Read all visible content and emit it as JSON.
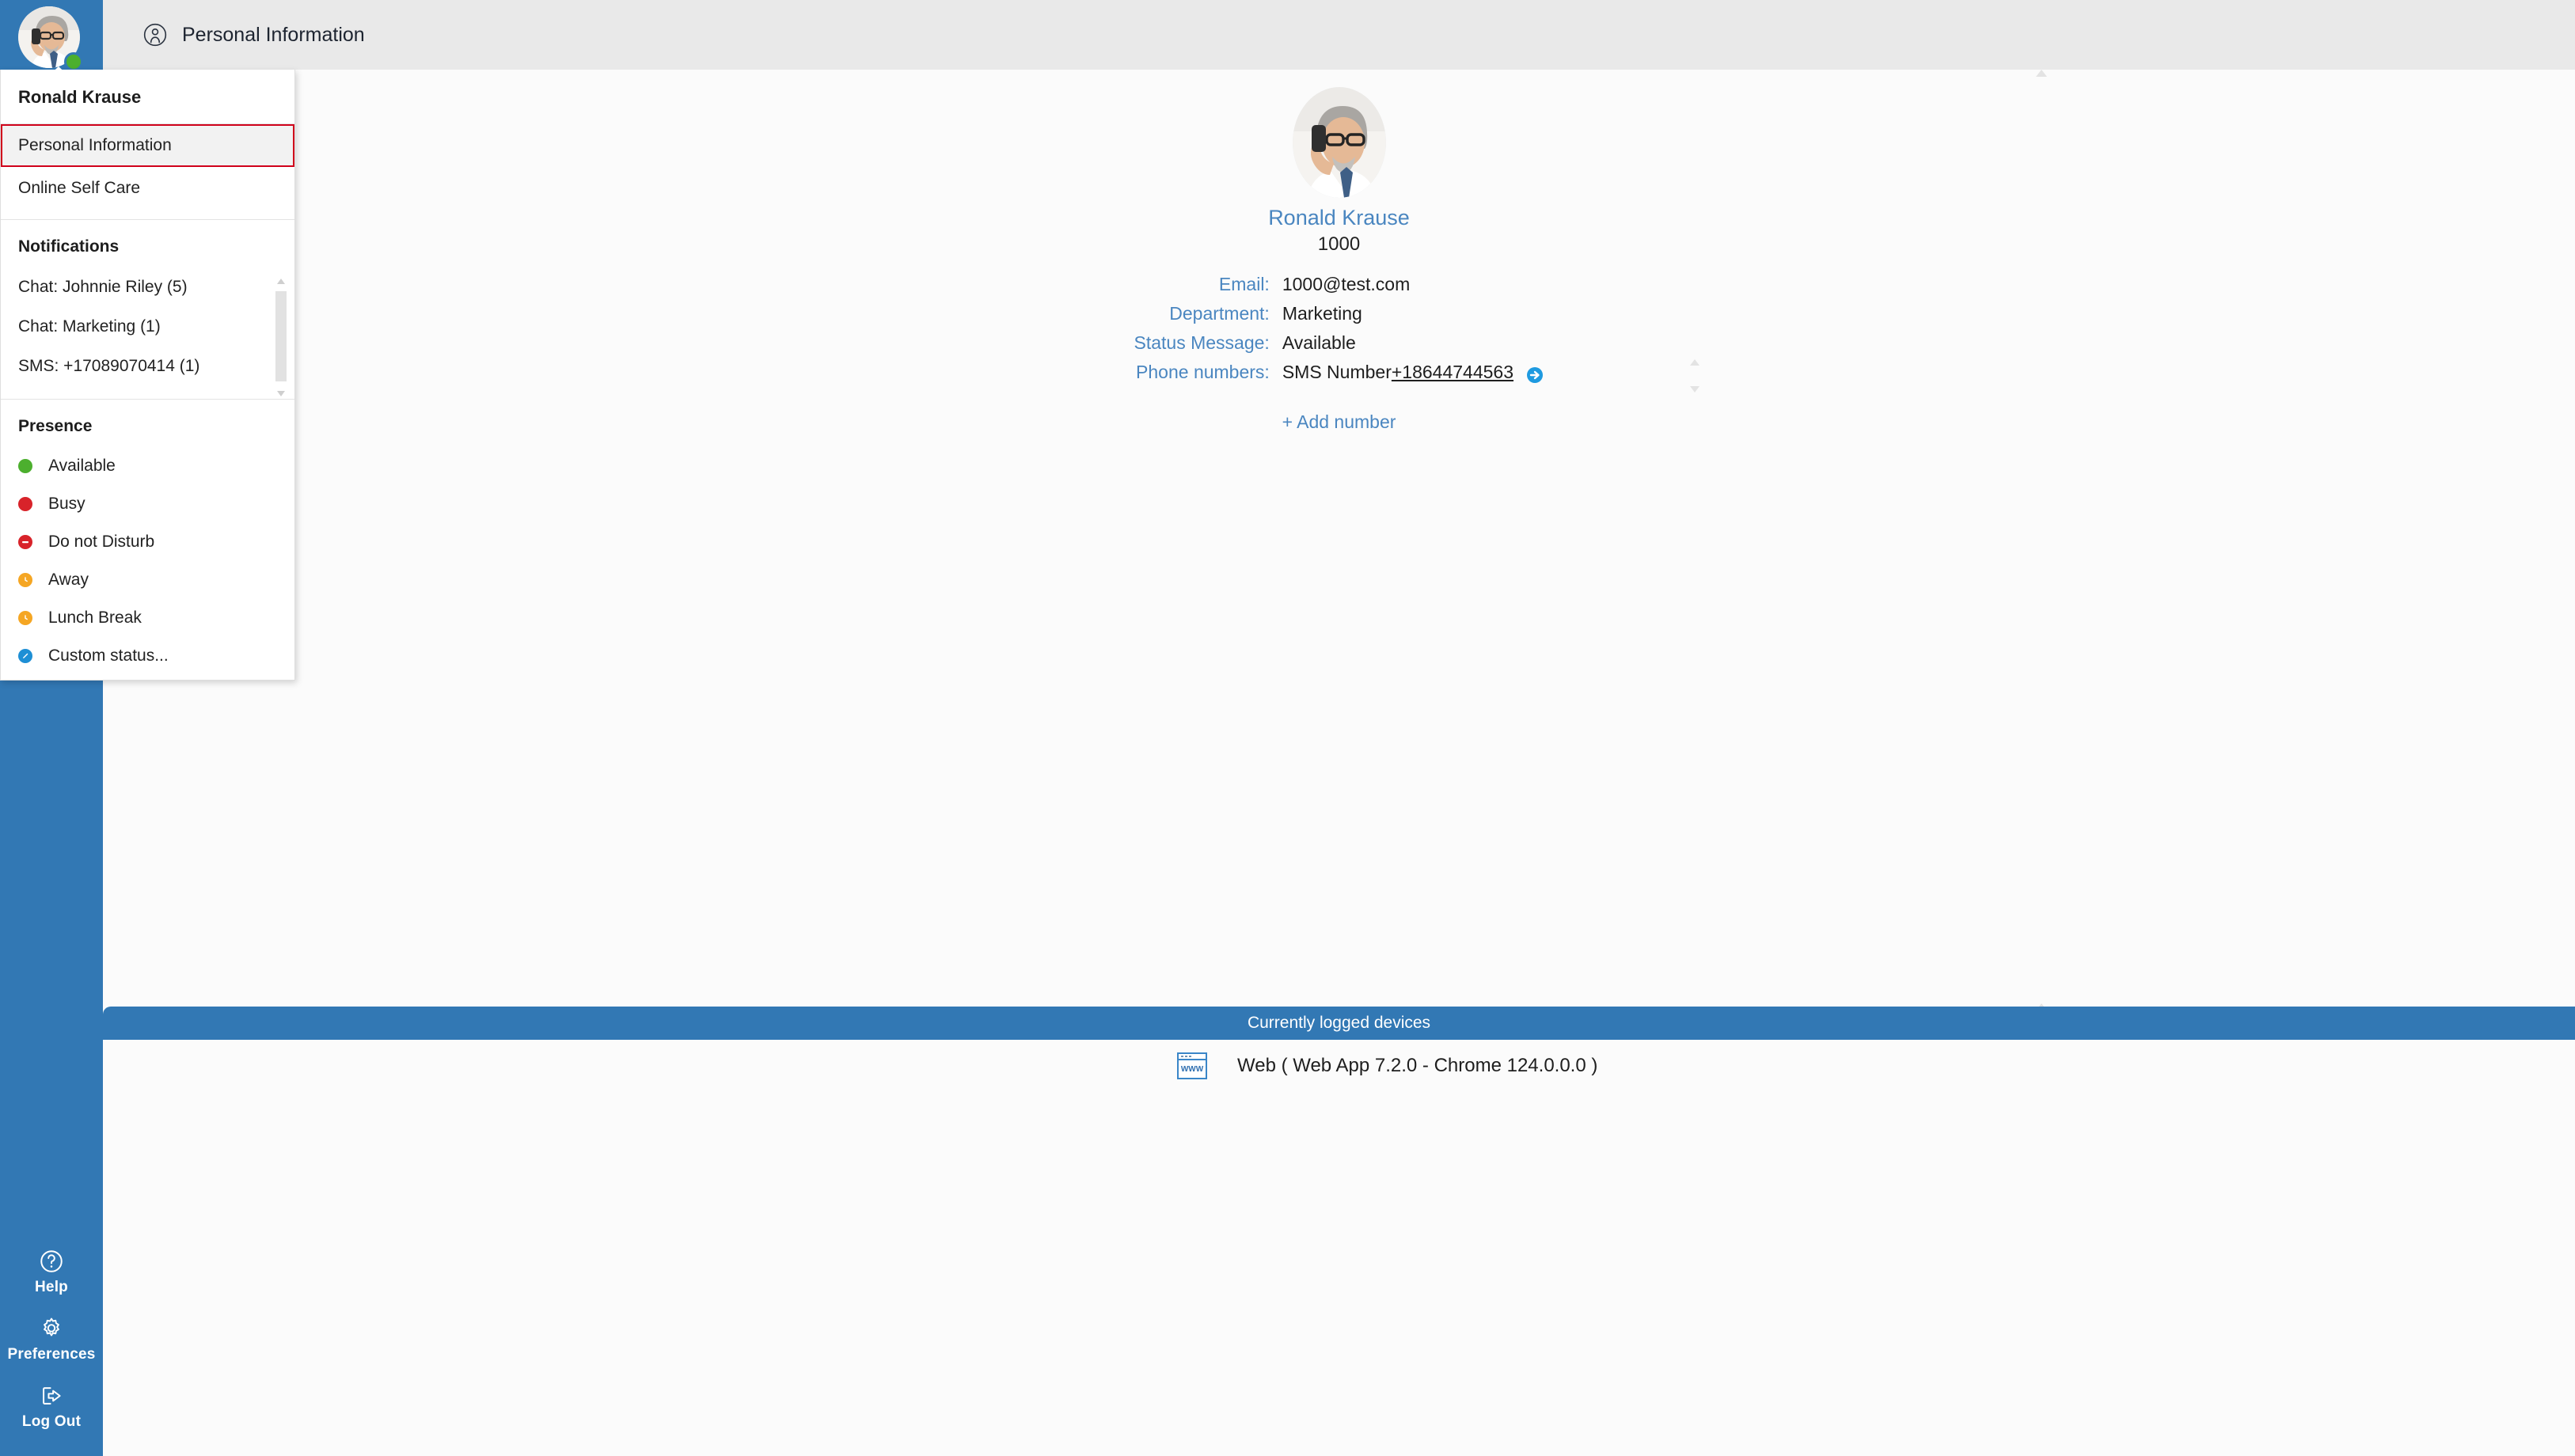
{
  "colors": {
    "rail_blue": "#3278b4",
    "header_grey": "#e9e9e9",
    "accent_link": "#4a86c0",
    "selected_border": "#d0021b",
    "available_green": "#4caf2e",
    "busy_red": "#d8232a",
    "away_orange": "#f5a623"
  },
  "rail": {
    "avatar": {
      "icon": "user-avatar-photo",
      "alt": "Ronald Krause avatar"
    },
    "presence_dot": {
      "icon": "presence-available-dot",
      "status": "Available"
    },
    "buttons": [
      {
        "icon": "help-circle-icon",
        "label": "Help"
      },
      {
        "icon": "gear-icon",
        "label": "Preferences"
      },
      {
        "icon": "logout-icon",
        "label": "Log Out"
      }
    ]
  },
  "header": {
    "icon": "person-circle-icon",
    "title": "Personal Information"
  },
  "dropdown": {
    "user_name": "Ronald Krause",
    "menu_items": [
      {
        "label": "Personal Information",
        "selected": true
      },
      {
        "label": "Online Self Care",
        "selected": false
      }
    ],
    "notifications": {
      "title": "Notifications",
      "items": [
        {
          "label": "Chat: Johnnie Riley (5)"
        },
        {
          "label": "Chat: Marketing (1)"
        },
        {
          "label": "SMS: +17089070414 (1)"
        }
      ],
      "scrollbar": {
        "icon_up": "scroll-up-arrow-icon",
        "icon_down": "scroll-down-arrow-icon"
      }
    },
    "presence": {
      "title": "Presence",
      "options": [
        {
          "label": "Available",
          "icon": "presence-available-icon",
          "color": "#4caf2e",
          "glyph": "dot"
        },
        {
          "label": "Busy",
          "icon": "presence-busy-icon",
          "color": "#d8232a",
          "glyph": "dot"
        },
        {
          "label": "Do not Disturb",
          "icon": "presence-dnd-icon",
          "color": "#d8232a",
          "glyph": "minus"
        },
        {
          "label": "Away",
          "icon": "presence-away-icon",
          "color": "#f5a623",
          "glyph": "clock"
        },
        {
          "label": "Lunch Break",
          "icon": "presence-lunch-icon",
          "color": "#f5a623",
          "glyph": "clock"
        },
        {
          "label": "Custom status...",
          "icon": "presence-custom-icon",
          "color": "#1e8fd5",
          "glyph": "pencil"
        }
      ]
    }
  },
  "profile": {
    "avatar_icon": "profile-photo",
    "name": "Ronald Krause",
    "extension": "1000",
    "details": [
      {
        "label": "Email:",
        "value": "1000@test.com"
      },
      {
        "label": "Department:",
        "value": "Marketing"
      },
      {
        "label": "Status Message:",
        "value": "Available"
      }
    ],
    "phone": {
      "label": "Phone numbers:",
      "type": "SMS Number",
      "number": "+18644744563",
      "action_icon": "sms-forward-icon"
    },
    "add_number_label": "+ Add number",
    "scroll_icons": {
      "row_up": "row-scroll-up-icon",
      "row_down": "row-scroll-down-icon",
      "page_up": "page-scroll-up-icon",
      "page_down": "page-scroll-down-icon"
    }
  },
  "devices": {
    "bar_title": "Currently logged devices",
    "items": [
      {
        "icon": "web-browser-icon",
        "label": "Web ( Web App 7.2.0 - Chrome 124.0.0.0 )"
      }
    ]
  }
}
